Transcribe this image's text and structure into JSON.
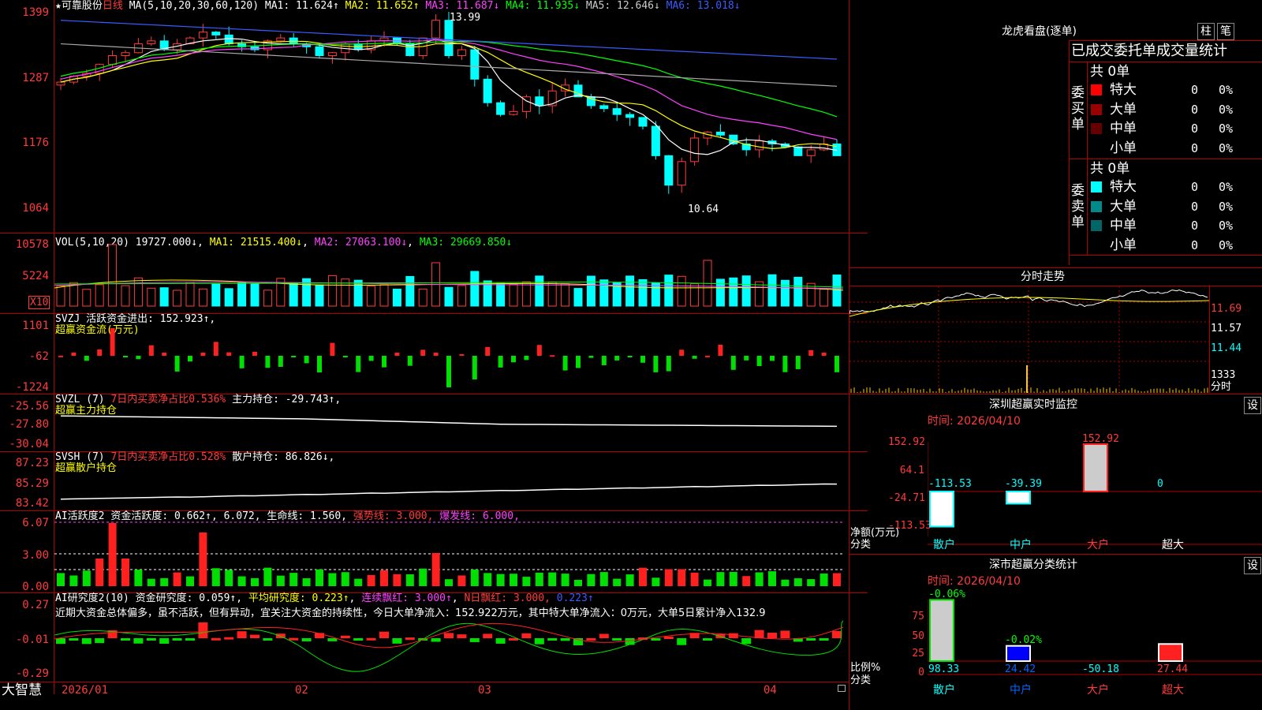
{
  "main": {
    "stock_name": "可靠股份",
    "period": "日线",
    "ma_header": "MA(5,10,20,30,60,120)",
    "ma": [
      {
        "label": "MA1: 11.624↑",
        "color": "#ffffff"
      },
      {
        "label": "MA2: 11.652↑",
        "color": "#ffff00"
      },
      {
        "label": "MA3: 11.687↓",
        "color": "#ff40ff"
      },
      {
        "label": "MA4: 11.935↓",
        "color": "#00ff00"
      },
      {
        "label": "MA5: 12.646↓",
        "color": "#cccccc"
      },
      {
        "label": "MA6: 13.018↓",
        "color": "#3a5cff"
      }
    ],
    "y_labels": [
      "1399",
      "1287",
      "1176",
      "1064"
    ],
    "high_mark": "13.99",
    "low_mark": "10.64",
    "x_labels": [
      "2026/01",
      "02",
      "03",
      "04"
    ],
    "logo_text": "大智慧"
  },
  "vol": {
    "header": "VOL(5,10,20)",
    "value": "19727.000↓",
    "ma": [
      "MA1: 21515.400↓",
      "MA2: 27063.100↓",
      "MA3: 29669.850↓"
    ],
    "y_labels": [
      "10578",
      "5224"
    ],
    "unit": "X10"
  },
  "svzj": {
    "header": "SVZJ",
    "title": "活跃资金进出: 152.923↑,",
    "subtitle": "超赢资金流(万元)",
    "y_labels": [
      "1101",
      "-62",
      "-1224"
    ]
  },
  "svzl": {
    "header": "SVZL (7)",
    "ratio": "7日内买卖净占比0.536%",
    "pos": "主力持仓: -29.743↑,",
    "subtitle": "超赢主力持仓",
    "y_labels": [
      "-25.56",
      "-27.80",
      "-30.04"
    ]
  },
  "svsh": {
    "header": "SVSH (7)",
    "ratio": "7日内买卖净占比0.528%",
    "pos": "散户持仓: 86.826↓,",
    "subtitle": "超赢散户持仓",
    "y_labels": [
      "87.23",
      "85.29",
      "83.42"
    ]
  },
  "ai1": {
    "header": "AI活跃度2",
    "a": "资金活跃度: 0.662↑",
    "b": ", 6.072,",
    "c": "生命线: 1.560,",
    "d": "强势线: 3.000,",
    "e": "爆发线: 6.000,",
    "y_labels": [
      "6.07",
      "3.00",
      "0.00"
    ]
  },
  "ai2": {
    "header": "AI研究度2(10)",
    "a": "资金研究度: 0.059↑",
    "b": "平均研究度: 0.223↑",
    "c": "连续飘红: 3.000↑",
    "d": "N日飘红: 3.000,",
    "e": "0.223↑",
    "comment": "近期大资金总体偏多，虽不活跃，但有异动，宜关注大资金的持续性，今日大单净流入：152.922万元，其中特大单净流入：0万元，大单5日累计净入132.9",
    "y_labels": [
      "0.27",
      "-0.01",
      "-0.29"
    ]
  },
  "right": {
    "title": "龙虎看盘(逐单)",
    "btn_bar": "柱",
    "btn_pen": "笔",
    "section_title": "已成交委托单成交量统计",
    "buy_label": "委买单",
    "sell_label": "委卖单",
    "buy_total": "共 0单",
    "sell_total": "共 0单",
    "rows": [
      "特大",
      "大单",
      "中单",
      "小单"
    ],
    "zero": "0",
    "pct": "0%",
    "intraday_title": "分时走势",
    "intraday_y": [
      "11.69",
      "11.57",
      "11.44",
      "1333"
    ],
    "intraday_unit": "分时",
    "sz_title": "深圳超赢实时监控",
    "set": "设",
    "date_label": "时间: 2026/04/10",
    "sz_y": [
      "152.92",
      "64.1",
      "-24.71",
      "-113.53"
    ],
    "sz_ylabel1": "净额(万元)",
    "sz_ylabel2": "分类",
    "sz_values": [
      "-113.53",
      "-39.39",
      "152.92",
      "0"
    ],
    "cats": [
      "散户",
      "中户",
      "大户",
      "超大"
    ],
    "stat_title": "深市超赢分类统计",
    "stat_y": [
      "75",
      "50",
      "25",
      "0"
    ],
    "stat_ylabel1": "比例%",
    "stat_ylabel2": "分类",
    "stat_top": [
      "-0.06%",
      "-0.02%"
    ],
    "stat_values": [
      "98.33",
      "24.42",
      "-50.18",
      "27.44"
    ]
  },
  "chart_data": {
    "type": "candlestick",
    "high": 13.99,
    "low": 10.64,
    "ma_last": [
      11.624,
      11.652,
      11.687,
      11.935,
      12.646,
      13.018
    ],
    "volume_last": 19727.0,
    "fund_flow_last": 152.923
  }
}
